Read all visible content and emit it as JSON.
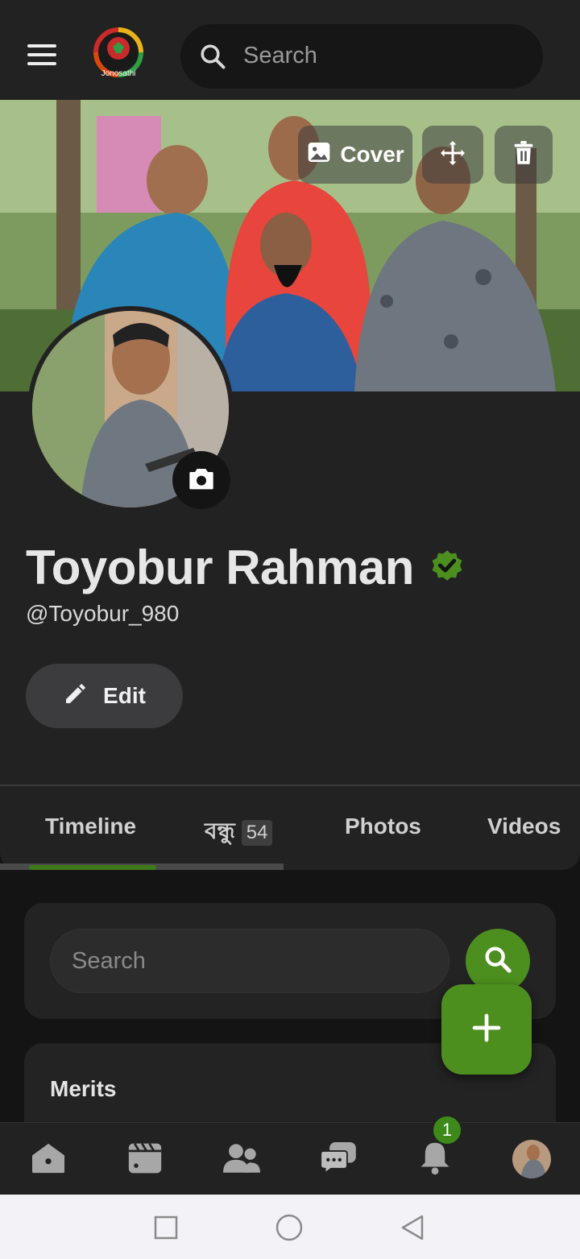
{
  "header": {
    "logo_text": "Jonosathi",
    "search_placeholder": "Search"
  },
  "cover": {
    "cover_label": "Cover"
  },
  "profile": {
    "name": "Toyobur Rahman",
    "handle": "@Toyobur_980",
    "verified": true,
    "edit_label": "Edit"
  },
  "tabs": [
    {
      "label": "Timeline",
      "active": true
    },
    {
      "label": "বন্ধু",
      "count": "54"
    },
    {
      "label": "Photos"
    },
    {
      "label": "Videos"
    }
  ],
  "content": {
    "search_placeholder": "Search",
    "merits_title": "Merits"
  },
  "bottom_nav": {
    "items": [
      "home-icon",
      "video-icon",
      "friends-icon",
      "chat-icon",
      "bell-icon",
      "profile-avatar"
    ],
    "notification_count": "1"
  },
  "colors": {
    "accent": "#4d8f1f",
    "background": "#141414",
    "surface": "#222222"
  }
}
